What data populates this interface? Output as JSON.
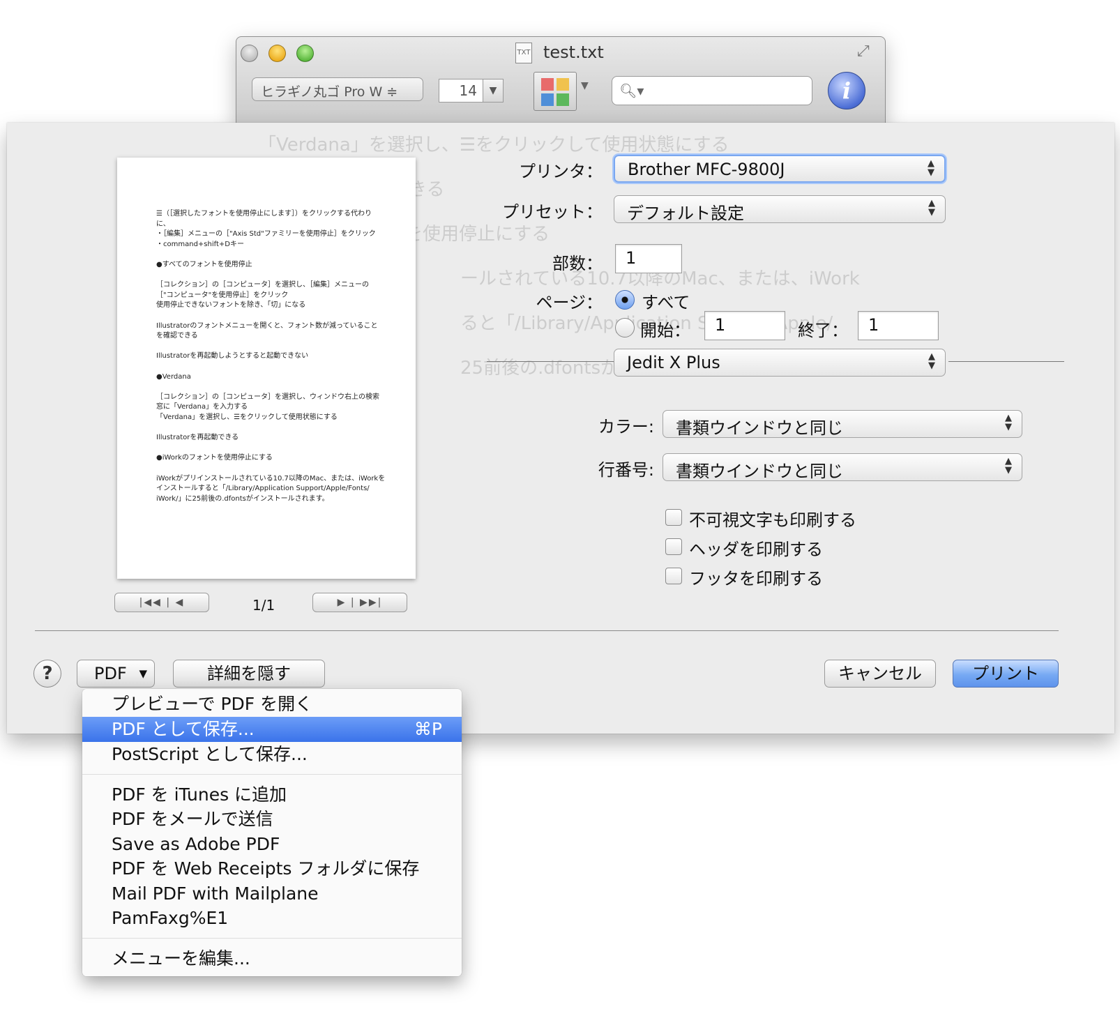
{
  "window": {
    "title": "test.txt",
    "doc_icon": "TXT",
    "font_popup": "ヒラギノ丸ゴ Pro W ≑",
    "font_size": "14",
    "search_placeholder": ""
  },
  "background_text": [
    "「Verdana」を選択し、☰をクリックして使用状態にする",
    "できる",
    "を使用停止にする",
    "ールされている10.7以降のMac、または、iWork",
    "ると「/Library/Application Support/Apple/",
    "25前後の.dfontsがイン"
  ],
  "preview": {
    "lines": [
      "☰（［選択したフォントを使用停止にします］）をクリックする代わり",
      "に、",
      "・［編集］メニューの［\"Axis Std\"ファミリーを使用停止］をクリック",
      "・command+shift+Dキー",
      "",
      "●すべてのフォントを使用停止",
      "",
      "［コレクション］の［コンピュータ］を選択し、［編集］メニューの",
      "［\"コンピュータ\"を使用停止］をクリック",
      "使用停止できないフォントを除き、「切」になる",
      "",
      "Illustratorのフォントメニューを開くと、フォント数が減っていること",
      "を確認できる",
      "",
      "Illustratorを再起動しようとすると起動できない",
      "",
      "●Verdana",
      "",
      "［コレクション］の［コンピュータ］を選択し、ウィンドウ右上の検索",
      "窓に「Verdana」を入力する",
      "「Verdana」を選択し、☰をクリックして使用状態にする",
      "",
      "Illustratorを再起動できる",
      "",
      "●iWorkのフォントを使用停止にする",
      "",
      "iWorkがプリインストールされている10.7以降のMac、または、iWorkを",
      "インストールすると「/Library/Application Support/Apple/Fonts/",
      "iWork/」に25前後の.dfontsがインストールされます。"
    ],
    "page_count": "1/1",
    "first_prev": "|◀◀ | ◀",
    "next_last": "▶ | ▶▶|"
  },
  "form": {
    "printer_label": "プリンタ：",
    "printer_value": "Brother MFC-9800J",
    "preset_label": "プリセット：",
    "preset_value": "デフォルト設定",
    "copies_label": "部数：",
    "copies_value": "1",
    "pages_label": "ページ：",
    "pages_all": "すべて",
    "pages_from_label": "開始：",
    "pages_from_value": "1",
    "pages_to_label": "終了：",
    "pages_to_value": "1",
    "app_popup": "Jedit X Plus",
    "color_label": "カラー:",
    "color_value": "書類ウインドウと同じ",
    "lineno_label": "行番号:",
    "lineno_value": "書類ウインドウと同じ",
    "checkboxes": [
      "不可視文字も印刷する",
      "ヘッダを印刷する",
      "フッタを印刷する"
    ]
  },
  "buttons": {
    "help": "?",
    "pdf": "PDF",
    "hide_details": "詳細を隠す",
    "cancel": "キャンセル",
    "print": "プリント"
  },
  "menu": {
    "items": [
      "プレビューで PDF を開く",
      "PDF として保存...",
      "PostScript として保存...",
      "PDF を iTunes に追加",
      "PDF をメールで送信",
      "Save as Adobe PDF",
      "PDF を Web Receipts フォルダに保存",
      "Mail PDF with Mailplane",
      "PamFaxg%E1",
      "メニューを編集..."
    ],
    "selected_shortcut": "⌘P",
    "selected_index": 1
  },
  "colors": {
    "accent": "#3a73ea",
    "close": "#ff5f57",
    "minimize": "#ffbd2e",
    "zoom": "#28c940"
  }
}
